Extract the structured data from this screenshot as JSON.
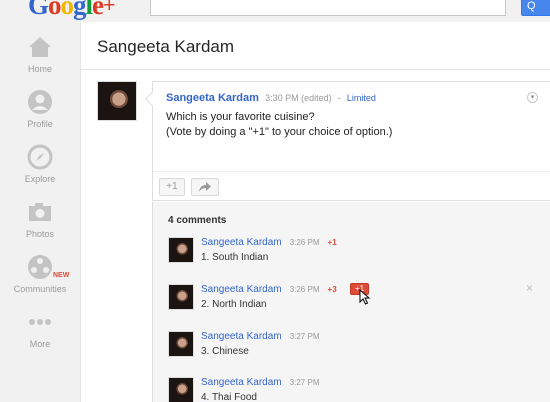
{
  "header": {
    "logo_text": "Google+",
    "search_button_label": "Q"
  },
  "sidebar": {
    "items": [
      {
        "label": "Home",
        "icon": "home-icon"
      },
      {
        "label": "Profile",
        "icon": "profile-icon"
      },
      {
        "label": "Explore",
        "icon": "explore-icon"
      },
      {
        "label": "Photos",
        "icon": "camera-icon"
      },
      {
        "label": "Communities",
        "icon": "communities-icon",
        "badge": "NEW"
      },
      {
        "label": "More",
        "icon": "more-icon"
      }
    ]
  },
  "page": {
    "title": "Sangeeta Kardam"
  },
  "post": {
    "author": "Sangeeta Kardam",
    "time": "3:30 PM (edited)",
    "separator": "-",
    "visibility": "Limited",
    "line1": "Which is your favorite cuisine?",
    "line2": "(Vote by doing a \"+1\" to your choice of option.)",
    "plus_one_label": "+1",
    "share_icon": "share-icon",
    "menu_icon": "chevron-down-icon"
  },
  "comments": {
    "count_label": "4 comments",
    "items": [
      {
        "author": "Sangeeta Kardam",
        "time": "3:26 PM",
        "plus": "+1",
        "text": "1. South Indian"
      },
      {
        "author": "Sangeeta Kardam",
        "time": "3:26 PM",
        "plus": "+3",
        "text": "2. North Indian",
        "active_plus_one": "+1",
        "close": "×"
      },
      {
        "author": "Sangeeta Kardam",
        "time": "3:27 PM",
        "plus": "",
        "text": "3. Chinese"
      },
      {
        "author": "Sangeeta Kardam",
        "time": "3:27 PM",
        "plus": "",
        "text": "4. Thai Food"
      }
    ]
  },
  "colors": {
    "accent_blue": "#3366cc",
    "plus_one_red": "#dd4b39",
    "search_blue": "#4787ed"
  }
}
